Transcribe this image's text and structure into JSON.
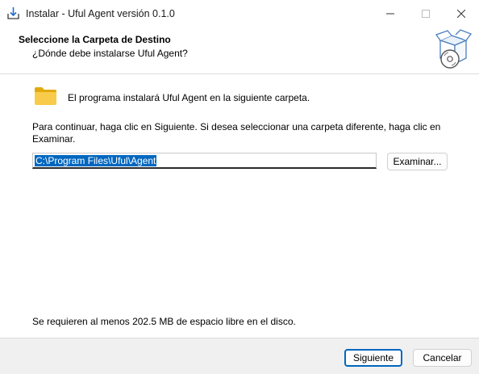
{
  "window": {
    "title": "Instalar - Uful Agent versión 0.1.0",
    "icons": {
      "app": "installer-download-icon",
      "minimize": "minimize-icon",
      "maximize": "maximize-icon",
      "close": "close-icon"
    }
  },
  "header": {
    "title": "Seleccione la Carpeta de Destino",
    "subtitle": "¿Dónde debe instalarse Uful Agent?",
    "icon": "box-with-disc-icon"
  },
  "main": {
    "folder_icon": "folder-icon",
    "info_text": "El programa instalará Uful Agent en la siguiente carpeta.",
    "instructions": "Para continuar, haga clic en Siguiente. Si desea seleccionar una carpeta diferente, haga clic en Examinar.",
    "path_value": "C:\\Program Files\\Uful\\Agent",
    "browse_label": "Examinar...",
    "space_text": "Se requieren al menos 202.5 MB de espacio libre en el disco."
  },
  "footer": {
    "next_label": "Siguiente",
    "cancel_label": "Cancelar"
  },
  "colors": {
    "accent": "#0067c0",
    "folder": "#f5c518",
    "footer_bg": "#f0f0f0"
  }
}
